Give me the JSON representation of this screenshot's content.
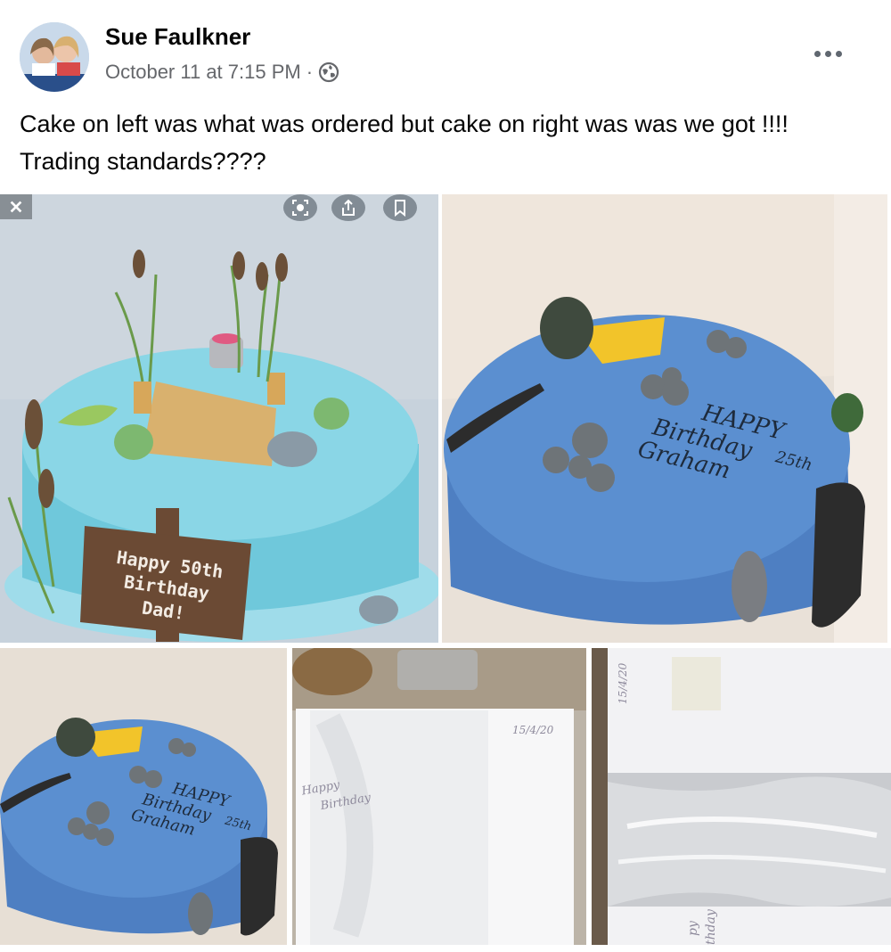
{
  "post": {
    "author": "Sue Faulkner",
    "timestamp": "October 11 at 7:15 PM",
    "separator": "·",
    "privacy_icon": "globe-icon",
    "more_icon": "more-options-icon",
    "text": "Cake on left was what was ordered but cake on right was was we got !!!! Trading standards????"
  },
  "photos": {
    "ordered_cake": {
      "sign_line1": "Happy 50th",
      "sign_line2": "Birthday",
      "sign_line3": "Dad!",
      "overlay_icons": [
        "close-icon",
        "lens-icon",
        "share-icon",
        "bookmark-icon"
      ]
    },
    "received_cake": {
      "line1": "HAPPY",
      "line2": "Birthday",
      "line3": "Graham",
      "age": "25th"
    },
    "received_cake_small": {
      "line1": "HAPPY",
      "line2": "Birthday",
      "line3": "Graham",
      "age": "25th"
    },
    "card": {
      "date": "15/4/20",
      "line1": "Happy",
      "line2": "Birthday"
    },
    "box": {
      "date": "15/4/20",
      "bottom1": "py",
      "bottom2": "thday"
    }
  },
  "colors": {
    "ordered_icing": "#7fd2e3",
    "received_icing": "#5a8ccc",
    "secondary_text": "#65676b"
  }
}
